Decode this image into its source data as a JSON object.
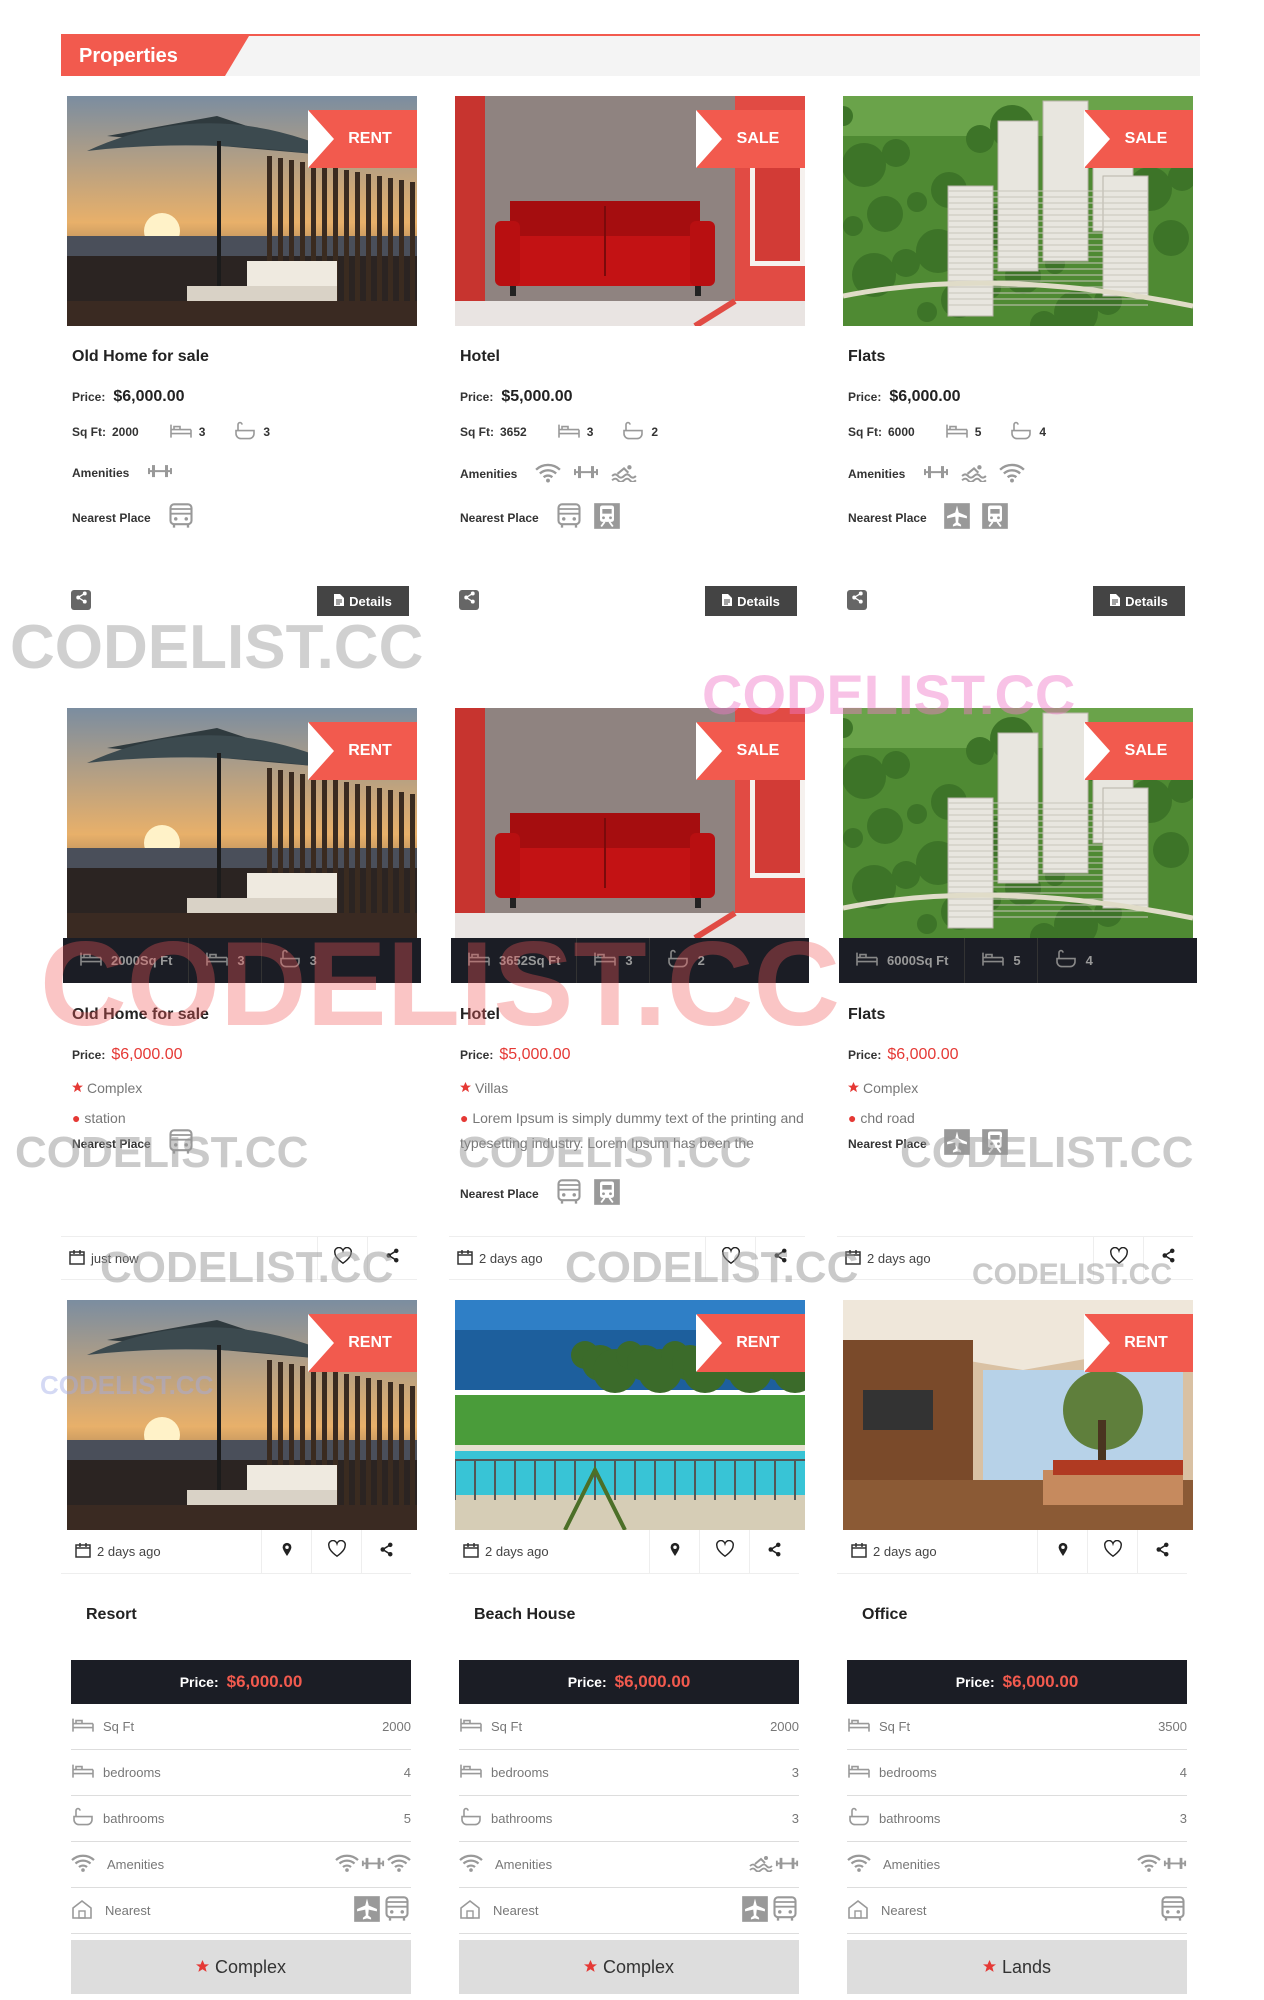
{
  "section_title": "Properties",
  "ribbons": {
    "rent": "RENT",
    "sale": "SALE"
  },
  "labels": {
    "price": "Price:",
    "sqft": "Sq Ft:",
    "amenities": "Amenities",
    "nearest_place": "Nearest Place",
    "details": "Details",
    "sqft_short": "Sq Ft",
    "bedrooms": "bedrooms",
    "bathrooms": "bathrooms",
    "nearest": "Nearest"
  },
  "row1": [
    {
      "title": "Old Home for sale",
      "ribbon": "RENT",
      "price": "$6,000.00",
      "sqft": "2000",
      "beds": "3",
      "baths": "3",
      "amenities": [
        "gym-icon"
      ],
      "nearest": [
        "bus-icon"
      ]
    },
    {
      "title": "Hotel",
      "ribbon": "SALE",
      "price": "$5,000.00",
      "sqft": "3652",
      "beds": "3",
      "baths": "2",
      "amenities": [
        "wifi-icon",
        "gym-icon",
        "pool-icon"
      ],
      "nearest": [
        "bus-icon",
        "train-icon"
      ]
    },
    {
      "title": "Flats",
      "ribbon": "SALE",
      "price": "$6,000.00",
      "sqft": "6000",
      "beds": "5",
      "baths": "4",
      "amenities": [
        "gym-icon",
        "pool-icon",
        "wifi-icon"
      ],
      "nearest": [
        "airplane-icon",
        "train-icon"
      ]
    }
  ],
  "row2": [
    {
      "title": "Old Home for sale",
      "ribbon": "RENT",
      "sqft": "2000Sq Ft",
      "beds": "3",
      "baths": "3",
      "price": "$6,000.00",
      "category": "Complex",
      "location": "station",
      "nearest": [
        "bus-icon"
      ],
      "time": "just now"
    },
    {
      "title": "Hotel",
      "ribbon": "SALE",
      "sqft": "3652Sq Ft",
      "beds": "3",
      "baths": "2",
      "price": "$5,000.00",
      "category": "Villas",
      "location": "Lorem Ipsum is simply dummy text of the printing and typesetting industry. Lorem Ipsum has been the",
      "nearest": [
        "bus-icon",
        "train-icon"
      ],
      "time": "2 days ago"
    },
    {
      "title": "Flats",
      "ribbon": "SALE",
      "sqft": "6000Sq Ft",
      "beds": "5",
      "baths": "4",
      "price": "$6,000.00",
      "category": "Complex",
      "location": "chd road",
      "nearest": [
        "airplane-icon",
        "train-icon"
      ],
      "time": "2 days ago"
    }
  ],
  "row3": [
    {
      "title": "Resort",
      "ribbon": "RENT",
      "time": "2 days ago",
      "price": "$6,000.00",
      "sqft": "2000",
      "bedrooms": "4",
      "bathrooms": "5",
      "amenities": [
        "wifi-icon",
        "gym-icon",
        "wifi-icon"
      ],
      "nearest": [
        "airplane-icon",
        "bus-icon"
      ],
      "category": "Complex"
    },
    {
      "title": "Beach House",
      "ribbon": "RENT",
      "time": "2 days ago",
      "price": "$6,000.00",
      "sqft": "2000",
      "bedrooms": "3",
      "bathrooms": "3",
      "amenities": [
        "pool-icon",
        "gym-icon"
      ],
      "nearest": [
        "airplane-icon",
        "bus-icon"
      ],
      "category": "Complex"
    },
    {
      "title": "Office",
      "ribbon": "RENT",
      "time": "2 days ago",
      "price": "$6,000.00",
      "sqft": "3500",
      "bedrooms": "4",
      "bathrooms": "3",
      "amenities": [
        "wifi-icon",
        "gym-icon"
      ],
      "nearest": [
        "bus-icon"
      ],
      "category": "Lands"
    }
  ],
  "watermark": "CODELIST.CC",
  "colors": {
    "accent": "#f25a4e",
    "dark": "#1b1d25",
    "price_red": "#e53935"
  }
}
